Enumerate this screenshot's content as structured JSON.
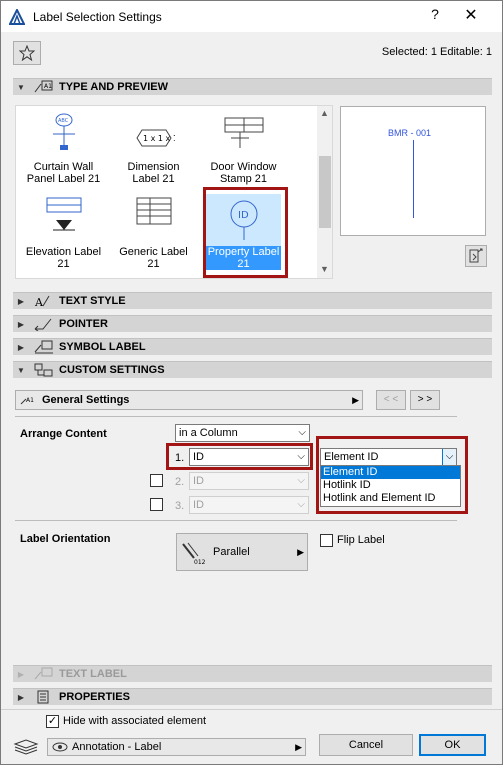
{
  "window": {
    "title": "Label Selection Settings",
    "help": "?",
    "close": "✕"
  },
  "header": {
    "selected_info": "Selected: 1 Editable: 1"
  },
  "panels": {
    "type_preview": "TYPE AND PREVIEW",
    "text_style": "TEXT STYLE",
    "pointer": "POINTER",
    "symbol_label": "SYMBOL LABEL",
    "custom_settings": "CUSTOM SETTINGS",
    "text_label": "TEXT LABEL",
    "properties": "PROPERTIES"
  },
  "tiles": [
    {
      "line1": "Curtain Wall",
      "line2": "Panel Label 21"
    },
    {
      "line1": "Dimension",
      "line2": "Label 21"
    },
    {
      "line1": "Door Window",
      "line2": "Stamp 21"
    },
    {
      "line1": "Elevation Label",
      "line2": "21"
    },
    {
      "line1": "Generic Label",
      "line2": "21"
    },
    {
      "line1": "Property Label",
      "line2": "21"
    }
  ],
  "tile_icons": {
    "dimension": "1 x 1 x 1",
    "property": "ID"
  },
  "preview": {
    "text": "BMR - 001"
  },
  "custom": {
    "section": "General Settings",
    "prev": "< <",
    "next": "> >",
    "arrange_label": "Arrange Content",
    "arrange_value": "in a Column",
    "row1_num": "1.",
    "row1_value": "ID",
    "row2_num": "2.",
    "row2_value": "ID",
    "row3_num": "3.",
    "row3_value": "ID",
    "id_type_value": "Element ID",
    "id_type_options": [
      "Element ID",
      "Hotlink ID",
      "Hotlink and Element ID"
    ],
    "orientation_label": "Label Orientation",
    "orientation_value": "Parallel",
    "flip_label": "Flip Label"
  },
  "footer": {
    "hide_label": "Hide with associated element",
    "layer_value": "Annotation - Label",
    "cancel": "Cancel",
    "ok": "OK"
  },
  "colors": {
    "selection": "#3399ff",
    "highlight_frame": "#a31515",
    "preview_blue": "#3355dd"
  }
}
